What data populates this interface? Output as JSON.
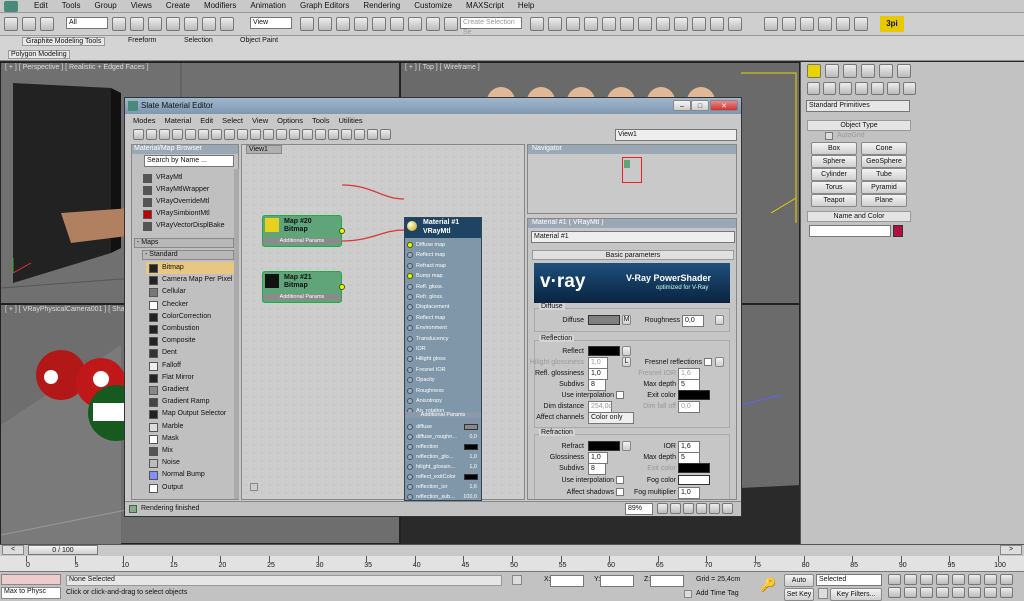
{
  "menubar": {
    "items": [
      "Edit",
      "Tools",
      "Group",
      "Views",
      "Create",
      "Modifiers",
      "Animation",
      "Graph Editors",
      "Rendering",
      "Customize",
      "MAXScript",
      "Help"
    ]
  },
  "toolbar": {
    "filter": "All",
    "view": "View",
    "selection_set": "Create Selection Se",
    "logo": "3pi"
  },
  "ribbon": {
    "tabs": [
      "Graphite Modeling Tools",
      "Freeform",
      "Selection",
      "Object Paint"
    ],
    "sub": "Polygon Modeling"
  },
  "viewports": {
    "perspective": "[ + ] [ Perspective ] [ Realistic + Edged Faces ]",
    "top": "[ + ] [ Top ] [ Wireframe ]",
    "camera": "[ + ] [ VRayPhysicalCamera001 ] [ Sha"
  },
  "command_panel": {
    "dropdown": "Standard Primitives",
    "object_type": "Object Type",
    "autogrid": "AutoGrid",
    "buttons": [
      "Box",
      "Cone",
      "Sphere",
      "GeoSphere",
      "Cylinder",
      "Tube",
      "Torus",
      "Pyramid",
      "Teapot",
      "Plane"
    ],
    "name_color": "Name and Color",
    "colors": {
      "swatch": "#b0103c"
    }
  },
  "slate": {
    "title": "Slate Material Editor",
    "menu": [
      "Modes",
      "Material",
      "Edit",
      "Select",
      "View",
      "Options",
      "Tools",
      "Utilities"
    ],
    "view_dropdown": "View1",
    "browser": {
      "header": "Material/Map Browser",
      "search": "Search by Name ...",
      "materials": [
        {
          "name": "VRayMtl",
          "color": "#555"
        },
        {
          "name": "VRayMtlWrapper",
          "color": "#555"
        },
        {
          "name": "VRayOverrideMtl",
          "color": "#555"
        },
        {
          "name": "VRaySimbiontMtl",
          "color": "#b00"
        },
        {
          "name": "VRayVectorDisplBake",
          "color": "#555"
        }
      ],
      "maps_header": "- Maps",
      "standard_header": "- Standard",
      "maps": [
        {
          "name": "Bitmap",
          "color": "#222"
        },
        {
          "name": "Camera Map Per Pixel",
          "color": "#222"
        },
        {
          "name": "Cellular",
          "color": "#777"
        },
        {
          "name": "Checker",
          "color": "#fff"
        },
        {
          "name": "ColorCorrection",
          "color": "#222"
        },
        {
          "name": "Combustion",
          "color": "#222"
        },
        {
          "name": "Composite",
          "color": "#222"
        },
        {
          "name": "Dent",
          "color": "#333"
        },
        {
          "name": "Falloff",
          "color": "#eee"
        },
        {
          "name": "Flat Mirror",
          "color": "#222"
        },
        {
          "name": "Gradient",
          "color": "#888"
        },
        {
          "name": "Gradient Ramp",
          "color": "#444"
        },
        {
          "name": "Map Output Selector",
          "color": "#222"
        },
        {
          "name": "Marble",
          "color": "#ddd"
        },
        {
          "name": "Mask",
          "color": "#fff"
        },
        {
          "name": "Mix",
          "color": "#555"
        },
        {
          "name": "Noise",
          "color": "#bbb"
        },
        {
          "name": "Normal Bump",
          "color": "#8090ff"
        },
        {
          "name": "Output",
          "color": "#fff"
        }
      ]
    },
    "view_tab": "View1",
    "nodes": {
      "map20": {
        "title": "Map #20",
        "type": "Bitmap",
        "params": "Additional Params"
      },
      "map21": {
        "title": "Map #21",
        "type": "Bitmap",
        "params": "Additional Params"
      },
      "mat": {
        "title": "Material #1",
        "type": "VRayMtl",
        "slots": [
          "Diffuse map",
          "Reflect map",
          "Refract map",
          "Bump map",
          "Refl. gloss.",
          "Refr. gloss.",
          "Displacement",
          "Reflect map",
          "Environment",
          "Translucency",
          "IOR",
          "Hilight gloss",
          "Fresnel IOR",
          "Opacity",
          "Roughness",
          "Anisotropy",
          "An. rotation"
        ],
        "params_label": "Additional Params",
        "params": [
          {
            "name": "diffuse",
            "value": ""
          },
          {
            "name": "diffuse_roughn...",
            "value": "0,0"
          },
          {
            "name": "reflection",
            "value": ""
          },
          {
            "name": "reflection_glo...",
            "value": "1,0"
          },
          {
            "name": "hilight_glossin...",
            "value": "1,0"
          },
          {
            "name": "reflect_exitColor",
            "value": ""
          },
          {
            "name": "reflection_ior",
            "value": "1,6"
          },
          {
            "name": "reflection_sub...",
            "value": "100,0"
          },
          {
            "name": "reflection_dim...",
            "value": "0,0"
          }
        ]
      }
    },
    "navigator": "Navigator",
    "param_title": "Material #1 ( VRayMtl )",
    "param_name": "Material #1",
    "basic": "Basic parameters",
    "banner": {
      "logo": "v·ray",
      "title": "V-Ray PowerShader",
      "sub": "optimized for V-Ray"
    },
    "diffuse": {
      "group": "Diffuse",
      "label": "Diffuse",
      "m": "M",
      "roughness_label": "Roughness",
      "roughness": "0,0"
    },
    "reflection": {
      "group": "Reflection",
      "reflect": "Reflect",
      "hilight_label": "Hilight glossiness",
      "hilight": "1,0",
      "l": "L",
      "fresnel": "Fresnel reflections",
      "fresnel_ior_label": "Fresnel IOR",
      "fresnel_ior": "1,6",
      "refl_gloss_label": "Refl. glossiness",
      "refl_gloss": "1,0",
      "max_depth_label": "Max depth",
      "max_depth": "5",
      "subdivs_label": "Subdivs",
      "subdivs": "8",
      "use_interp": "Use interpolation",
      "exit_color": "Exit color",
      "dim_dist_label": "Dim distance",
      "dim_dist": "254,0c",
      "dim_falloff_label": "Dim fall off",
      "dim_falloff": "0,0",
      "affect_label": "Affect channels",
      "affect": "Color only"
    },
    "refraction": {
      "group": "Refraction",
      "refract": "Refract",
      "ior_label": "IOR",
      "ior": "1,6",
      "gloss_label": "Glossiness",
      "gloss": "1,0",
      "max_depth_label": "Max depth",
      "max_depth": "5",
      "subdivs_label": "Subdivs",
      "subdivs": "8",
      "exit_color": "Exit color",
      "use_interp": "Use interpolation",
      "fog_color": "Fog color",
      "affect_shadows": "Affect shadows",
      "fog_mult_label": "Fog multiplier",
      "fog_mult": "1,0"
    },
    "status": "Rendering finished",
    "zoom": "89%"
  },
  "timeline": {
    "slider": "0 / 100",
    "ticks": [
      "0",
      "5",
      "10",
      "15",
      "20",
      "25",
      "30",
      "35",
      "40",
      "45",
      "50",
      "55",
      "60",
      "65",
      "70",
      "75",
      "80",
      "85",
      "90",
      "95",
      "100"
    ]
  },
  "statusbar": {
    "maxscript": "Max to Physc",
    "selected": "None Selected",
    "hint": "Click or click-and-drag to select objects",
    "x": "X:",
    "y": "Y:",
    "z": "Z:",
    "grid": "Grid = 25,4cm",
    "add_time_tag": "Add Time Tag",
    "auto_key": "Auto Key",
    "set_key": "Set Key",
    "selected_dd": "Selected",
    "key_filters": "Key Filters..."
  }
}
